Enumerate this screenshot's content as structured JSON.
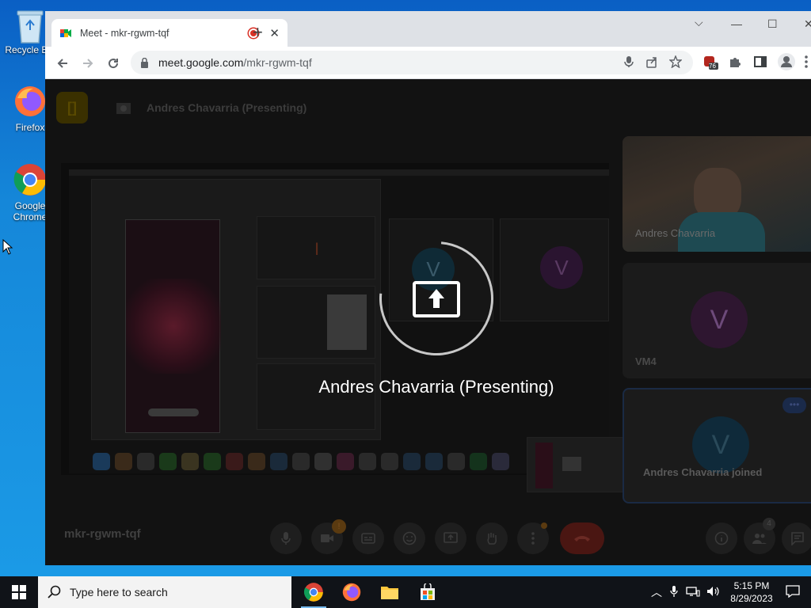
{
  "desktop": {
    "icons": [
      {
        "label": "Recycle Bin",
        "icon": "recycle-bin-icon"
      },
      {
        "label": "Firefox",
        "icon": "firefox-icon"
      },
      {
        "label": "Google Chrome",
        "icon": "chrome-icon"
      }
    ]
  },
  "browser": {
    "tab_title": "Meet - mkr-rgwm-tqf",
    "new_tab": "+",
    "url_host": "meet.google.com",
    "url_path": "/mkr-rgwm-tqf",
    "extension_badge": "76"
  },
  "meet": {
    "presenter_header": "Andres Chavarria (Presenting)",
    "presenting_label": "Andres Chavarria (Presenting)",
    "meeting_code": "mkr-rgwm-tqf",
    "participant_count": "4",
    "tiles": [
      {
        "name": "Andres Chavarria"
      },
      {
        "name": "VM4",
        "avatar": "V"
      },
      {
        "name": "Andres Chavarria joined",
        "avatar": "V"
      }
    ],
    "stage_avatars": [
      "V",
      "V"
    ],
    "stage_letter": "I",
    "accent_color": "#d93025"
  },
  "taskbar": {
    "search_placeholder": "Type here to search",
    "time": "5:15 PM",
    "date": "8/29/2023"
  }
}
